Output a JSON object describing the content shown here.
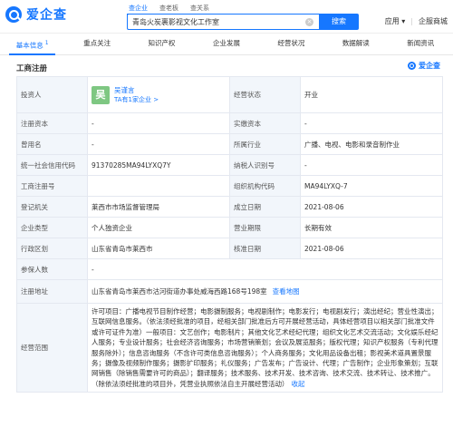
{
  "header": {
    "logo_text": "爱企查",
    "search_tabs": [
      "查企业",
      "查老板",
      "查关系"
    ],
    "search_value": "青岛火炭裹影视文化工作室",
    "clear_icon": "×",
    "search_button": "搜索",
    "links": [
      "应用",
      "|",
      "企服商城"
    ],
    "app_chevron": "▾"
  },
  "tabs": [
    {
      "label": "基本信息",
      "count": "1"
    },
    {
      "label": "重点关注",
      "count": ""
    },
    {
      "label": "知识产权",
      "count": ""
    },
    {
      "label": "企业发展",
      "count": ""
    },
    {
      "label": "经营状况",
      "count": ""
    },
    {
      "label": "数据解读",
      "count": ""
    },
    {
      "label": "新闻资讯",
      "count": ""
    }
  ],
  "section": {
    "title": "工商注册",
    "watermark": "爱企查"
  },
  "registration": {
    "investor_label": "投资人",
    "investor_avatar": "吴",
    "investor_name": "吴谨言",
    "investor_tag": "TA有1家企业 >",
    "status_label": "经营状态",
    "status_value": "开业",
    "reg_capital_label": "注册资本",
    "reg_capital_value": "-",
    "paid_capital_label": "实缴资本",
    "paid_capital_value": "-",
    "former_name_label": "曾用名",
    "former_name_value": "-",
    "industry_label": "所属行业",
    "industry_value": "广播、电视、电影和录音制作业",
    "credit_code_label": "统一社会信用代码",
    "credit_code_value": "91370285MA94LYXQ7Y",
    "taxpayer_label": "纳税人识别号",
    "taxpayer_value": "-",
    "reg_number_label": "工商注册号",
    "reg_number_value": "",
    "org_code_label": "组织机构代码",
    "org_code_value": "MA94LYXQ-7",
    "authority_label": "登记机关",
    "authority_value": "莱西市市场监督管理局",
    "established_label": "成立日期",
    "established_value": "2021-08-06",
    "type_label": "企业类型",
    "type_value": "个人独资企业",
    "term_label": "营业期限",
    "term_value": "长期有效",
    "region_label": "行政区划",
    "region_value": "山东省青岛市莱西市",
    "approved_label": "核准日期",
    "approved_value": "2021-08-06",
    "insured_label": "参保人数",
    "insured_value": "-",
    "address_label": "注册地址",
    "address_value": "山东省青岛市莱西市沽河街道办事处威海西路168号198室",
    "map_link": "查看地图",
    "scope_label": "经营范围",
    "scope_value": "许可项目：广播电视节目制作经营；电影摄制服务；电视剧制作；电影发行；电视剧发行；演出经纪；营业性演出；互联网信息服务。（依法须经批准的项目，经相关部门批准后方可开展经营活动，具体经营项目以相关部门批准文件或许可证件为准）一般项目：文艺创作；电影制片；其他文化艺术经纪代理；组织文化艺术交流活动；文化娱乐经纪人服务；专业设计服务；社会经济咨询服务；市场营销策划；会议及展览服务；版权代理；知识产权服务（专利代理服务除外）；信息咨询服务（不含许可类信息咨询服务）；个人商务服务；文化用品设备出租；影视美术道具置景服务；摄像及视频制作服务；摄影扩印服务；礼仪服务；广告发布；广告设计、代理；广告制作；企业形象策划；互联网销售（除销售需要许可的商品）；翻译服务；技术服务、技术开发、技术咨询、技术交流、技术转让、技术推广。（除依法须经批准的项目外，凭营业执照依法自主开展经营活动）",
    "scope_more": "收起"
  }
}
